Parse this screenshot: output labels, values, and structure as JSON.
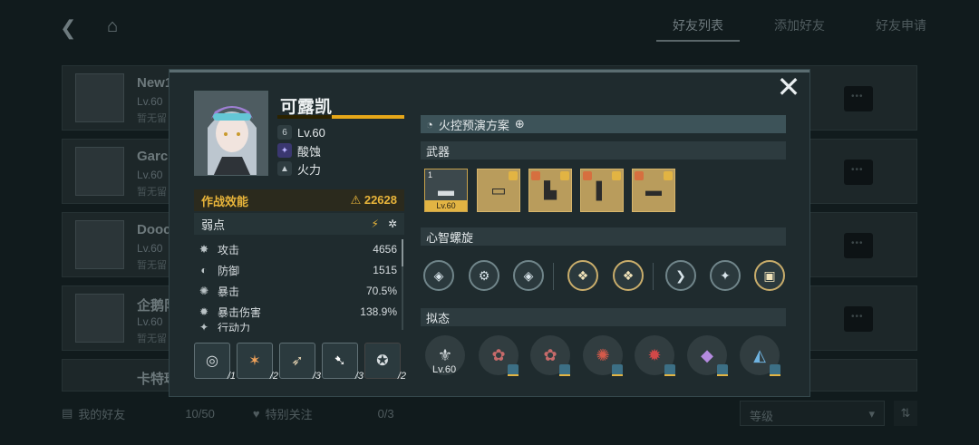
{
  "background": {
    "tabs": [
      "好友列表",
      "添加好友",
      "好友申请"
    ],
    "friends": [
      {
        "name": "New1",
        "lv": "Lv.60",
        "status": "暂无留"
      },
      {
        "name": "Garcl",
        "lv": "Lv.60",
        "status": "暂无留"
      },
      {
        "name": "Dooc",
        "lv": "Lv.60",
        "status": "暂无留"
      },
      {
        "name": "企鹅队",
        "lv": "Lv.60",
        "status": "暂无留"
      },
      {
        "name": "卡特琳",
        "lv": "",
        "status": ""
      }
    ],
    "bottom": {
      "friends_label": "我的好友",
      "friends_count": "10/50",
      "follow_label": "特别关注",
      "follow_count": "0/3",
      "sort_label": "等级"
    }
  },
  "character": {
    "name": "可露凯",
    "level": "Lv.60",
    "element": "酸蚀",
    "weapon_type": "火力",
    "power_label": "作战效能",
    "power_value": "22628",
    "weak_label": "弱点",
    "stats": [
      {
        "label": "攻击",
        "value": "4656",
        "icon": "attack-icon"
      },
      {
        "label": "防御",
        "value": "1515",
        "icon": "defense-icon"
      },
      {
        "label": "暴击",
        "value": "70.5%",
        "icon": "crit-icon"
      },
      {
        "label": "暴击伤害",
        "value": "138.9%",
        "icon": "crit-damage-icon"
      },
      {
        "label": "行动力",
        "value": "",
        "icon": "action-icon"
      }
    ],
    "skills": [
      {
        "level": "/1"
      },
      {
        "level": "/2"
      },
      {
        "level": "/3"
      },
      {
        "level": "/3"
      },
      {
        "level": "/2"
      }
    ]
  },
  "loadout": {
    "plan_label": "火控预演方案",
    "weapon_section": "武器",
    "weapon_level": "Lv.60",
    "weapon_rank": "1",
    "helix_section": "心智螺旋",
    "mimic_section": "拟态",
    "mimic_level": "Lv.60"
  },
  "colors": {
    "accent": "#e6a719",
    "panel": "#1f2b2e"
  }
}
